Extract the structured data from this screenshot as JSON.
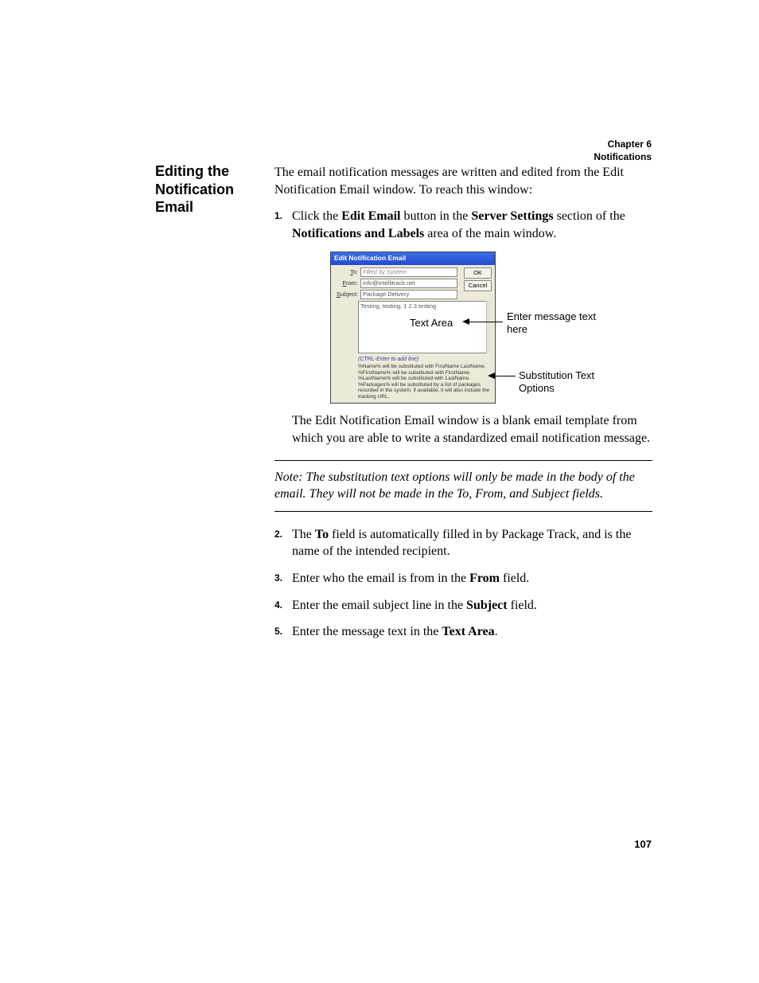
{
  "header": {
    "chapter": "Chapter 6",
    "section": "Notifications"
  },
  "sectionTitle": "Editing the Notification Email",
  "intro": "The email notification messages are written and edited from the Edit Notification Email window. To reach this window:",
  "step1": {
    "num": "1.",
    "pre": "Click the ",
    "b1": "Edit Email",
    "mid1": " button in the ",
    "b2": "Server Settings",
    "mid2": " section of the ",
    "b3": "Notifications and Labels",
    "post": " area of the main window."
  },
  "dialog": {
    "title": "Edit Notification Email",
    "toLabelU": "T",
    "toLabelRest": "o:",
    "toValue": "Filled by System",
    "fromLabelU": "F",
    "fromLabelRest": "rom:",
    "fromValue": "info@intellitrack.net",
    "subjectLabelU": "S",
    "subjectLabelRest": "ubject:",
    "subjectValue": "Package Delivery",
    "bodyValue": "Testing, testing, 1 2 3 testing",
    "ok": "OK",
    "cancel": "Cancel",
    "hint": "(CTRL-Enter to add line)",
    "sub1": "%Name% will be substituted with FirstName LastName.",
    "sub2": "%FirstName% will be substituted with FirstName.",
    "sub3": "%LastName% will be substituted with LastName.",
    "sub4": "%Packages% will be substituted by a list of packages recorded in the system. If available, it will also include the tracking URL."
  },
  "calloutTextArea": "Text Area",
  "calloutEnter": "Enter message text here",
  "calloutSubs": "Substitution Text Options",
  "afterFigure": "The Edit Notification Email window is a blank email template from which you are able to write a standardized email notification message.",
  "note": "Note:   The substitution text options will only be made in the body of the email. They will not be made in the To, From, and Subject fields.",
  "step2": {
    "num": "2.",
    "pre": "The ",
    "b1": "To",
    "post": " field is automatically filled in by Package Track, and is the name of the intended recipient."
  },
  "step3": {
    "num": "3.",
    "pre": "Enter who the email is from in the ",
    "b1": "From",
    "post": " field."
  },
  "step4": {
    "num": "4.",
    "pre": "Enter the email subject line in the ",
    "b1": "Subject",
    "post": " field."
  },
  "step5": {
    "num": "5.",
    "pre": "Enter the message text in the ",
    "b1": "Text Area",
    "post": "."
  },
  "pageNumber": "107"
}
